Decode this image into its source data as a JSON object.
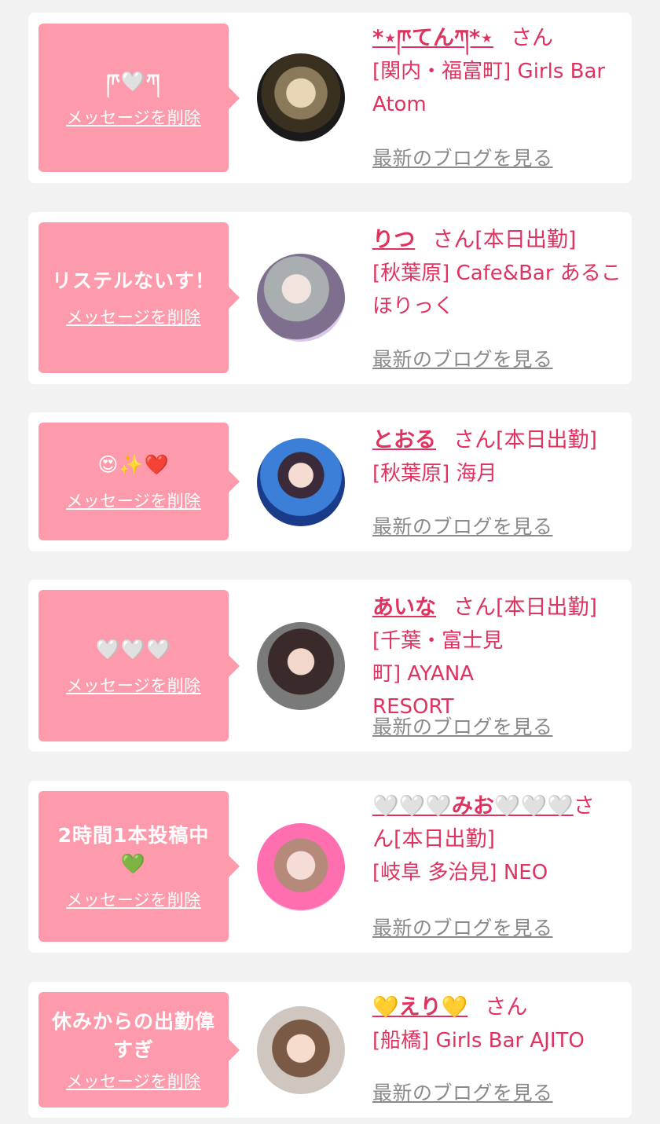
{
  "delete_label": "メッセージを削除",
  "blog_label": "最新のブログを見る",
  "san_label": "さん",
  "accent_color": "#e0325f",
  "bubble_color": "#fd9aab",
  "entries": [
    {
      "message": "ཫ🤍ཀ",
      "name": "*⋆ཫてんཀ*⋆",
      "status": "",
      "shop": "[関内・福富町] Girls Bar Atom"
    },
    {
      "message": "リステルないす！",
      "name": "りつ",
      "status": "[本日出勤]",
      "shop": "[秋葉原] Cafe&Bar あるこほりっく"
    },
    {
      "message": "😍✨❤️",
      "name": "とおる",
      "status": "[本日出勤]",
      "shop": "[秋葉原] 海月"
    },
    {
      "message": "🤍🤍🤍",
      "name": "あいな",
      "status": "[本日出勤]",
      "shop": "[千葉・富士見町] AYANA RESORT"
    },
    {
      "message": "2時間1本投稿中💚",
      "name": "🤍🤍🤍みお🤍🤍🤍",
      "status": "[本日出勤]",
      "shop": "[岐阜 多治見] NEO"
    },
    {
      "message": "休みからの出勤偉すぎ",
      "name": "💛えり💛",
      "status": "",
      "shop": "[船橋] Girls Bar AJITO"
    }
  ]
}
